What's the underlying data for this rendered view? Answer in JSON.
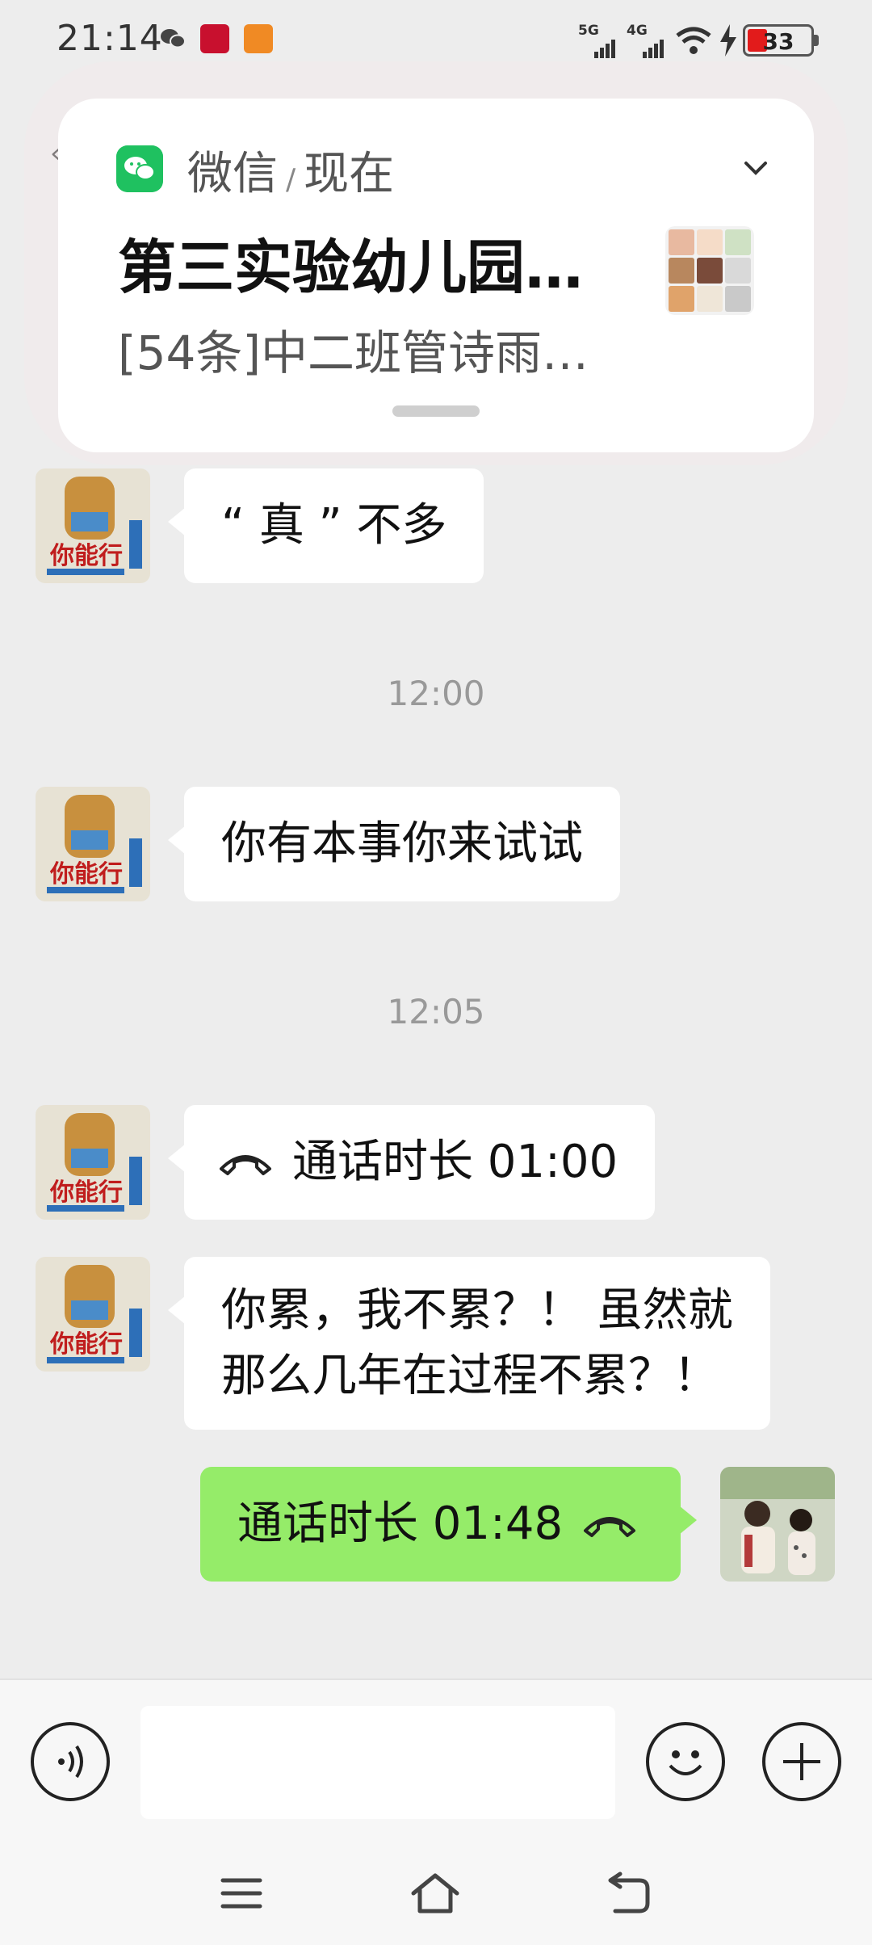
{
  "status_bar": {
    "time": "21:14",
    "network_1": "5G",
    "network_2": "4G",
    "battery": "33",
    "icons": [
      "wechat-icon",
      "red-app-icon",
      "orange-app-icon",
      "signal-icon",
      "wifi-icon",
      "charging-icon",
      "battery-icon"
    ]
  },
  "notification": {
    "app_name": "微信",
    "separator": "/",
    "time_label": "现在",
    "title": "第三实验幼儿园…",
    "body": "[54条]中二班管诗雨…",
    "colors": {
      "wechat_green": "#1fc160"
    }
  },
  "chat": {
    "messages": [
      {
        "side": "left",
        "text": "“ 真 ” 不多"
      },
      {
        "type": "time",
        "text": "12:00"
      },
      {
        "side": "left",
        "text": "你有本事你来试试"
      },
      {
        "type": "time",
        "text": "12:05"
      },
      {
        "side": "left",
        "type": "call",
        "text": "通话时长 01:00"
      },
      {
        "side": "left",
        "text_line1": "你累，我不累？！ 虽然就",
        "text_line2": "那么几年在过程不累？！"
      },
      {
        "side": "right",
        "type": "call",
        "text": "通话时长 01:48"
      }
    ],
    "colors": {
      "incoming_bubble": "#ffffff",
      "outgoing_bubble": "#95ec69",
      "background": "#ededed"
    }
  },
  "input_bar": {
    "icons": [
      "voice-icon",
      "emoji-icon",
      "plus-icon"
    ],
    "text_value": ""
  },
  "nav_bar": {
    "icons": [
      "menu-icon",
      "home-icon",
      "back-icon"
    ]
  }
}
